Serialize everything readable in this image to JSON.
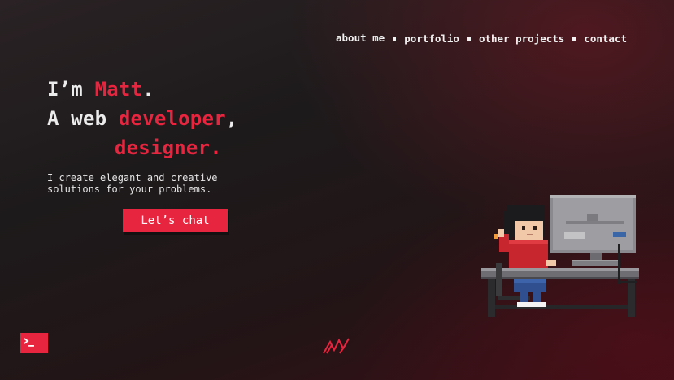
{
  "nav": {
    "items": [
      {
        "label": "about me",
        "active": true
      },
      {
        "label": "portfolio",
        "active": false
      },
      {
        "label": "other projects",
        "active": false
      },
      {
        "label": "contact",
        "active": false
      }
    ]
  },
  "hero": {
    "line1_prefix": "I’m ",
    "line1_name": "Matt",
    "line1_suffix": ".",
    "line2_prefix": "A web ",
    "line2_role": "developer",
    "line2_suffix": ",",
    "line3_role": "designer."
  },
  "description": {
    "line1": "I create elegant and creative",
    "line2": "solutions for your problems."
  },
  "cta": {
    "label": "Let’s chat"
  },
  "icons": {
    "terminal": "terminal-icon",
    "logo": "logo-mark-icon",
    "illustration": "pixel-developer-at-computer"
  },
  "colors": {
    "accent": "#e8253f",
    "text": "#ececec",
    "background_dark": "#1d1a1b",
    "background_red": "#3a0f17"
  }
}
